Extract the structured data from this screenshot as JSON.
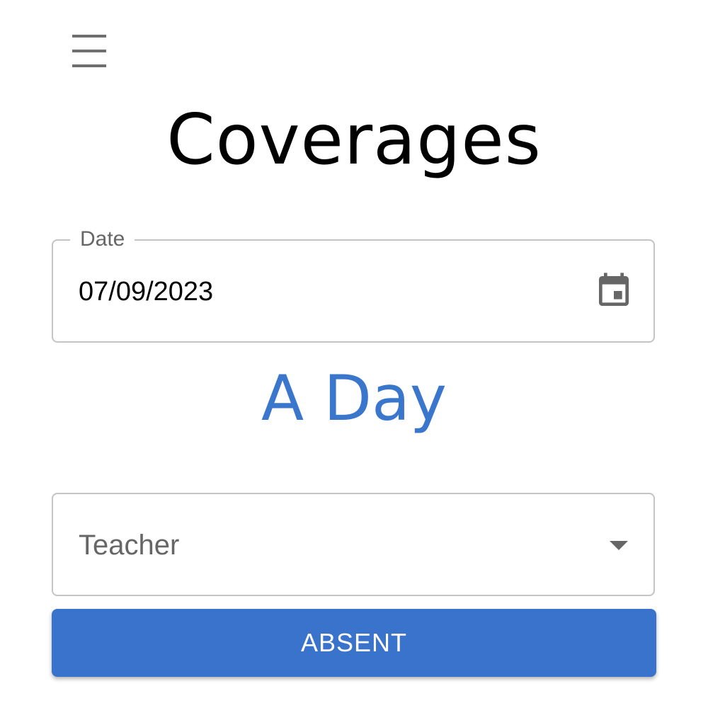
{
  "header": {
    "menu_icon": "hamburger-menu-icon",
    "title": "Coverages"
  },
  "date_field": {
    "label": "Date",
    "value": "07/09/2023",
    "icon": "calendar-icon"
  },
  "day_label": "A Day",
  "teacher_select": {
    "placeholder": "Teacher",
    "icon": "caret-down-icon"
  },
  "absent_button": {
    "label": "ABSENT"
  },
  "colors": {
    "accent": "#3a73cc",
    "day_text": "#3a77cc",
    "border": "#c4c4c4",
    "label_text": "#666666"
  }
}
